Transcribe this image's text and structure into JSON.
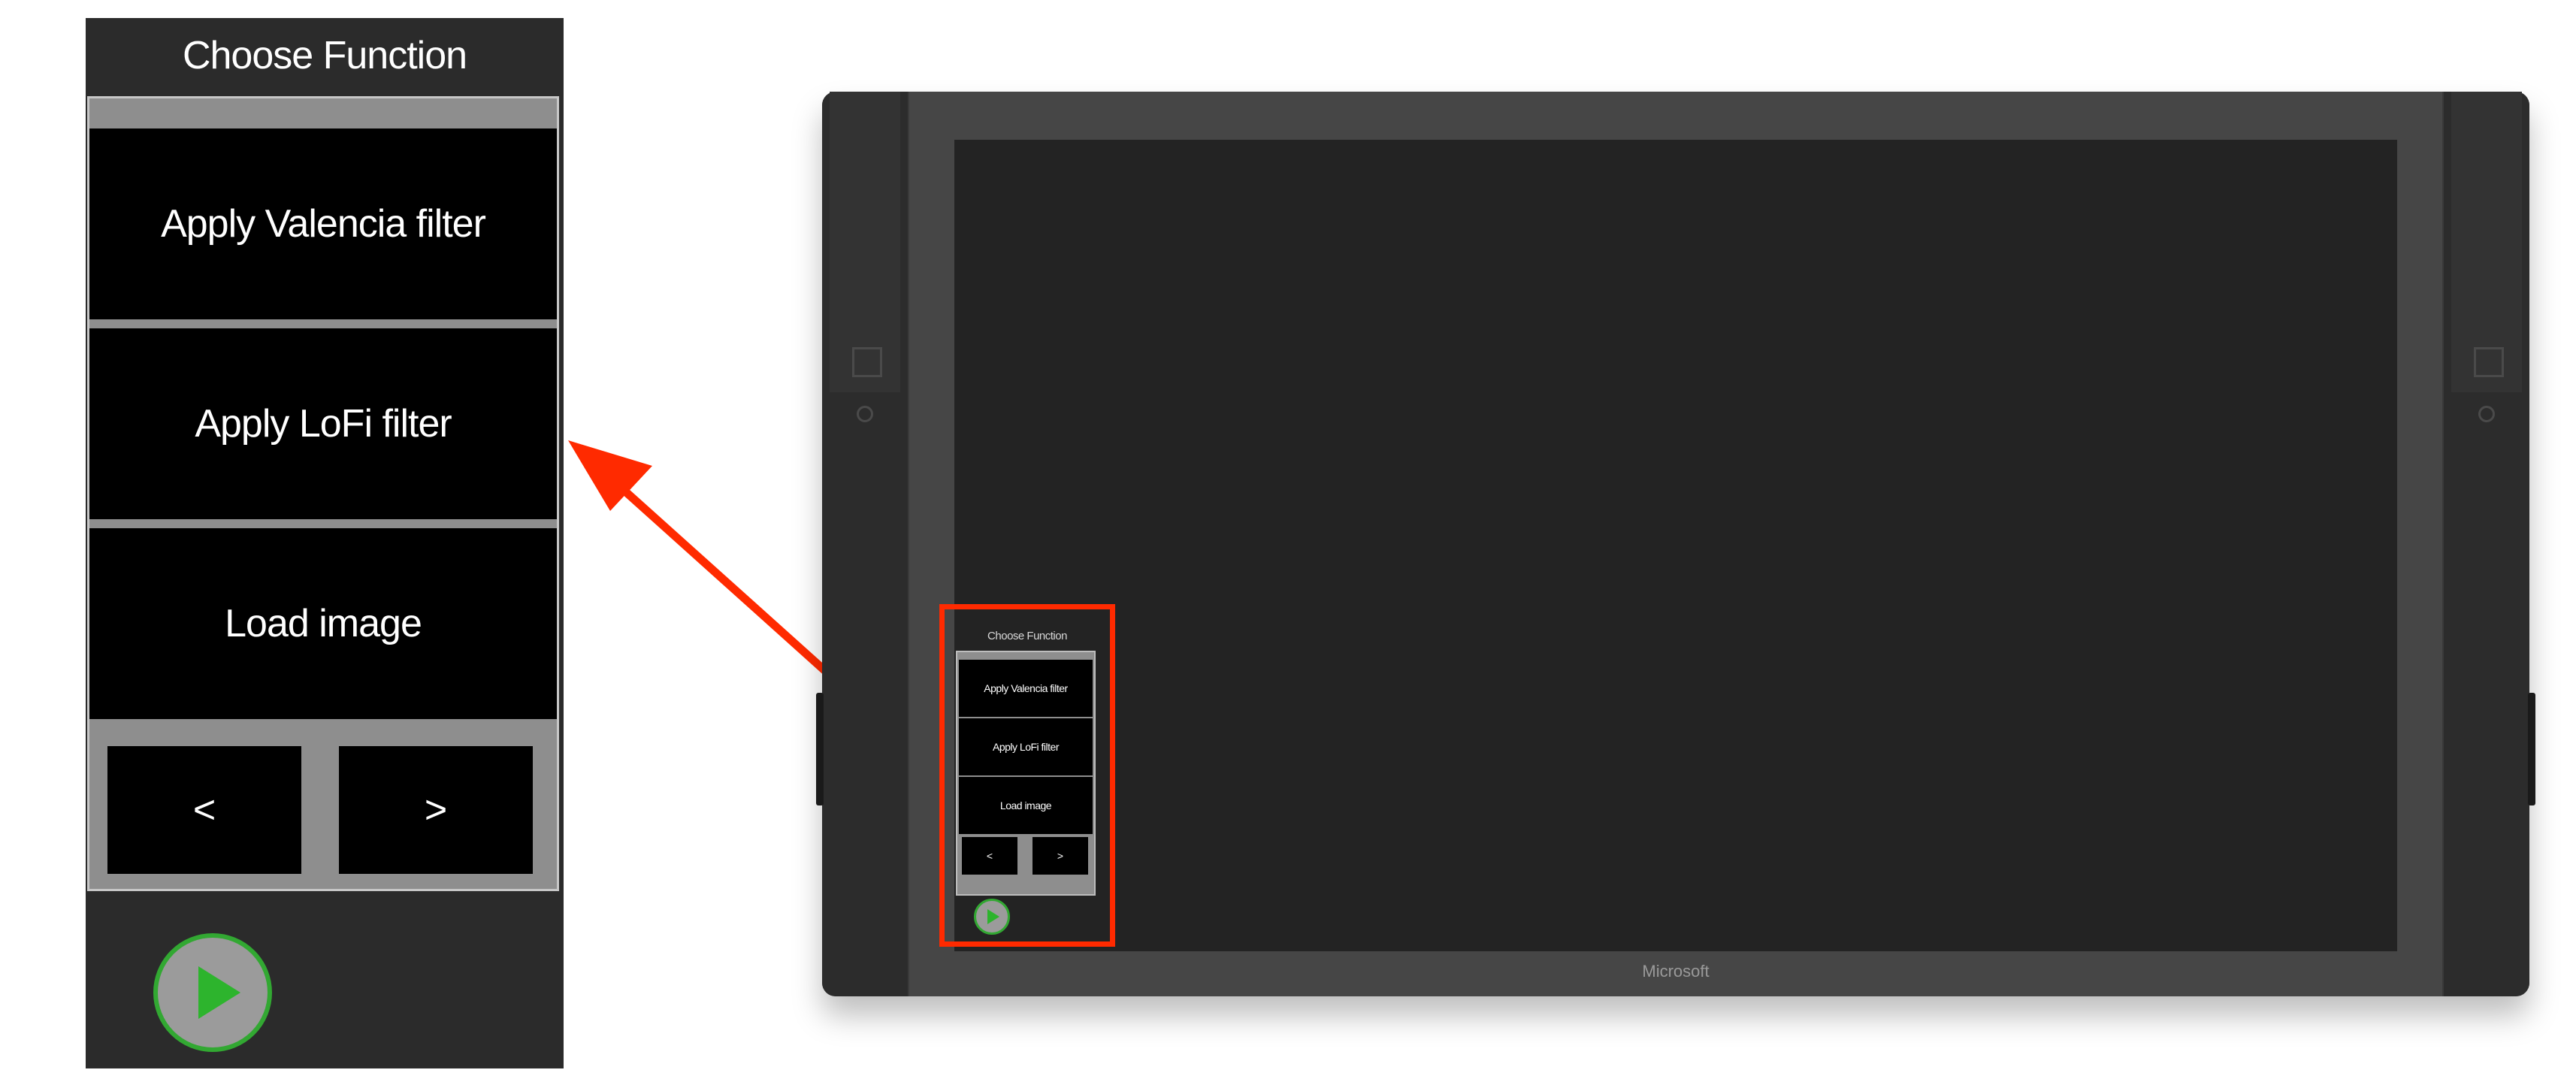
{
  "zoom_panel": {
    "title": "Choose Function",
    "buttons": [
      "Apply Valencia filter",
      "Apply LoFi filter",
      "Load image"
    ],
    "prev_label": "<",
    "next_label": ">",
    "play_icon": "play-icon"
  },
  "device": {
    "brand": "Microsoft",
    "mini_panel": {
      "title": "Choose Function",
      "buttons": [
        "Apply Valencia filter",
        "Apply LoFi filter",
        "Load image"
      ],
      "prev_label": "<",
      "next_label": ">"
    }
  },
  "colors": {
    "highlight": "#ff2a00",
    "play_green": "#32a832",
    "panel_bg": "#2b2b2b",
    "button_bg": "#000000"
  }
}
